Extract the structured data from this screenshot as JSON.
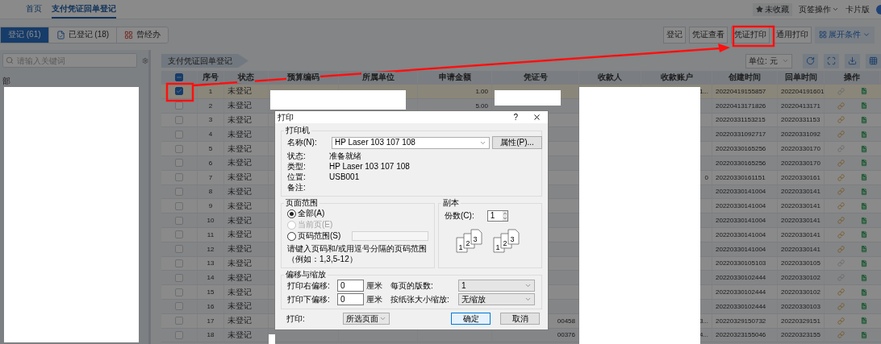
{
  "nav": {
    "items": [
      {
        "label": "首页",
        "selected": false
      },
      {
        "label": "支付凭证回单登记",
        "selected": true
      }
    ],
    "favorite": "未收藏",
    "tab_ops": "页签操作",
    "view_mode": "卡片版"
  },
  "filter_tabs": [
    {
      "label": "登记 (61)",
      "kind": "pending",
      "selected": true
    },
    {
      "label": "已登记 (18)",
      "kind": "done",
      "selected": false
    },
    {
      "label": "曾经办",
      "kind": "history",
      "selected": false
    }
  ],
  "toolbar": [
    {
      "label": "登记",
      "kind": "plain"
    },
    {
      "label": "凭证查看",
      "kind": "plain"
    },
    {
      "label": "凭证打印",
      "kind": "plain"
    },
    {
      "label": "通用打印",
      "kind": "plain"
    },
    {
      "label": "展开条件",
      "kind": "expand"
    }
  ],
  "sidebar": {
    "search_placeholder": "请输入关键词",
    "items": [
      {
        "label": "部"
      }
    ]
  },
  "breadcrumb": "支付凭证回单登记",
  "unit_select": {
    "label": "单位:",
    "value": "元"
  },
  "table": {
    "select_all_indeterminate": true,
    "columns": [
      "序号",
      "状态",
      "预算编码",
      "所属单位",
      "申请金额",
      "凭证号",
      "收款人",
      "收款账户",
      "创建时间",
      "回单时间",
      "操作"
    ],
    "rows": [
      {
        "checked": true,
        "no": "1",
        "status": "未登记",
        "amount": "1.00",
        "account": "1...",
        "created": "20220419155857",
        "receipt_time": "202204191601",
        "linked": false
      },
      {
        "checked": false,
        "no": "2",
        "status": "未登记",
        "amount": "5.00",
        "created": "20220413171826",
        "receipt_time": "20220413171",
        "linked": true
      },
      {
        "checked": false,
        "no": "3",
        "status": "未登记",
        "created": "20220331153215",
        "receipt_time": "20220331153",
        "linked": true
      },
      {
        "checked": false,
        "no": "4",
        "status": "未登记",
        "created": "20220331092717",
        "receipt_time": "20220331092",
        "linked": true
      },
      {
        "checked": false,
        "no": "5",
        "status": "未登记",
        "created": "20220330165256",
        "receipt_time": "20220330170",
        "linked": false
      },
      {
        "checked": false,
        "no": "6",
        "status": "未登记",
        "created": "20220330165256",
        "receipt_time": "20220330170",
        "linked": true
      },
      {
        "checked": false,
        "no": "7",
        "status": "未登记",
        "account": "0",
        "created": "20220330161151",
        "receipt_time": "20220330161",
        "linked": true
      },
      {
        "checked": false,
        "no": "8",
        "status": "未登记",
        "created": "20220330141004",
        "receipt_time": "20220330141",
        "linked": true
      },
      {
        "checked": false,
        "no": "9",
        "status": "未登记",
        "created": "20220330141004",
        "receipt_time": "20220330141",
        "linked": true
      },
      {
        "checked": false,
        "no": "10",
        "status": "未登记",
        "created": "20220330141004",
        "receipt_time": "20220330141",
        "linked": true
      },
      {
        "checked": false,
        "no": "11",
        "status": "未登记",
        "created": "20220330141004",
        "receipt_time": "20220330141",
        "linked": true
      },
      {
        "checked": false,
        "no": "12",
        "status": "未登记",
        "created": "20220330141004",
        "receipt_time": "20220330141",
        "linked": true
      },
      {
        "checked": false,
        "no": "13",
        "status": "未登记",
        "created": "20220330105103",
        "receipt_time": "20220330105",
        "linked": false
      },
      {
        "checked": false,
        "no": "14",
        "status": "未登记",
        "created": "20220330102444",
        "receipt_time": "20220330102",
        "linked": false
      },
      {
        "checked": false,
        "no": "15",
        "status": "未登记",
        "created": "20220330102444",
        "receipt_time": "20220330102",
        "linked": true
      },
      {
        "checked": false,
        "no": "16",
        "status": "未登记",
        "created": "20220330102444",
        "receipt_time": "20220330103",
        "linked": true
      },
      {
        "checked": false,
        "no": "17",
        "status": "未登记",
        "voucher": "00458",
        "account": "3...",
        "created": "20220329150732",
        "receipt_time": "20220329151",
        "linked": true
      },
      {
        "checked": false,
        "no": "18",
        "status": "未登记",
        "voucher": "00376",
        "account": "4...",
        "created": "20220323155046",
        "receipt_time": "20220323155",
        "linked": true
      }
    ]
  },
  "dialog": {
    "title": "打印",
    "help": "?",
    "printer": {
      "legend": "打印机",
      "name_label": "名称(N):",
      "name": "HP Laser 103 107 108",
      "properties": "属性(P)...",
      "info": [
        {
          "label": "状态:",
          "value": "准备就绪"
        },
        {
          "label": "类型:",
          "value": "HP Laser 103 107 108"
        },
        {
          "label": "位置:",
          "value": "USB001"
        },
        {
          "label": "备注:"
        }
      ]
    },
    "page_range": {
      "legend": "页面范围",
      "options": [
        {
          "label": "全部(A)",
          "selected": true,
          "disabled": false
        },
        {
          "label": "当前页(E)",
          "selected": false,
          "disabled": true
        },
        {
          "label": "页码范围(S)",
          "selected": false,
          "disabled": false
        }
      ],
      "hint": "请键入页码和/或用逗号分隔的页码范围",
      "example": "（例如：1,3,5-12）"
    },
    "copies": {
      "legend": "副本",
      "label": "份数(C):",
      "value": "1",
      "collate": [
        [
          "1",
          "2",
          "3"
        ],
        [
          "1",
          "2",
          "3"
        ]
      ]
    },
    "offset": {
      "legend": "偏移与缩放",
      "fields": [
        {
          "label": "打印右偏移:",
          "value": "0",
          "unit": "厘米"
        },
        {
          "label": "打印下偏移:",
          "value": "0",
          "unit": "厘米"
        }
      ],
      "selects": [
        {
          "label": "每页的版数:",
          "value": "1"
        },
        {
          "label": "按纸张大小缩放:",
          "value": "无缩放"
        }
      ]
    },
    "print": {
      "label": "打印:",
      "value": "所选页面"
    },
    "buttons": [
      {
        "label": "确定",
        "default": true
      },
      {
        "label": "取消",
        "default": false
      }
    ]
  }
}
